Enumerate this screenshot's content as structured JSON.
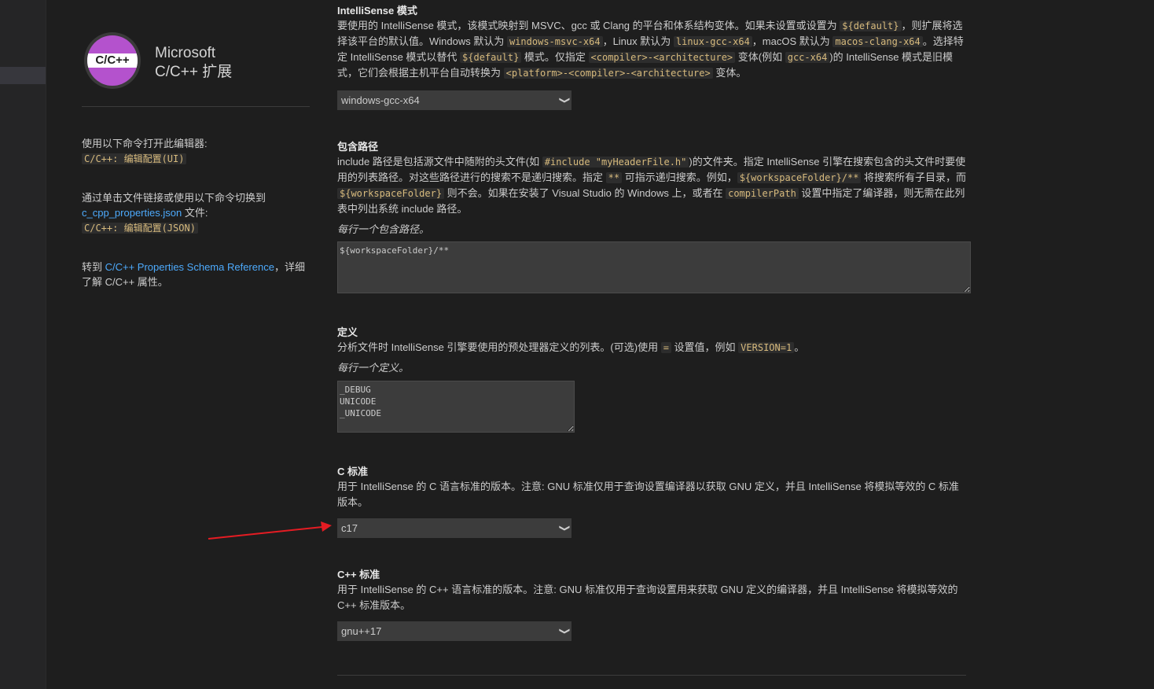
{
  "extension": {
    "logo_text": "C/C++",
    "title_line1": "Microsoft",
    "title_line2": "C/C++ 扩展"
  },
  "sidebar": {
    "open_with_text": "使用以下命令打开此编辑器:",
    "open_ui_command": "C/C++: 编辑配置(UI)",
    "switch_text": "通过单击文件链接或使用以下命令切换到",
    "json_link": "c_cpp_properties.json",
    "json_suffix": " 文件:",
    "open_json_command": "C/C++: 编辑配置(JSON)",
    "goto_prefix": "转到 ",
    "schema_link": "C/C++ Properties Schema Reference",
    "goto_suffix": "，详细了解 C/C++ 属性。"
  },
  "intellisense_mode": {
    "title": "IntelliSense 模式",
    "desc": [
      {
        "t": "要使用的 IntelliSense 模式，该模式映射到 MSVC、gcc 或 Clang 的平台和体系结构变体。如果未设置或设置为 "
      },
      {
        "c": "${default}"
      },
      {
        "t": "，则扩展将选择该平台的默认值。Windows 默认为 "
      },
      {
        "c": "windows-msvc-x64"
      },
      {
        "t": "，Linux 默认为 "
      },
      {
        "c": "linux-gcc-x64"
      },
      {
        "t": "，macOS 默认为 "
      },
      {
        "c": "macos-clang-x64"
      },
      {
        "t": "。选择特定 IntelliSense 模式以替代 "
      },
      {
        "c": "${default}"
      },
      {
        "t": " 模式。仅指定 "
      },
      {
        "c": "<compiler>-<architecture>"
      },
      {
        "t": " 变体(例如 "
      },
      {
        "c": "gcc-x64"
      },
      {
        "t": ")的 IntelliSense 模式是旧模式，它们会根据主机平台自动转换为 "
      },
      {
        "c": "<platform>-<compiler>-<architecture>"
      },
      {
        "t": " 变体。"
      }
    ],
    "value": "windows-gcc-x64"
  },
  "include_path": {
    "title": "包含路径",
    "desc": [
      {
        "t": "include 路径是包括源文件中随附的头文件(如 "
      },
      {
        "c": "#include \"myHeaderFile.h\""
      },
      {
        "t": ")的文件夹。指定 IntelliSense 引擎在搜索包含的头文件时要使用的列表路径。对这些路径进行的搜索不是递归搜索。指定 "
      },
      {
        "c": "**"
      },
      {
        "t": " 可指示递归搜索。例如，"
      },
      {
        "c": "${workspaceFolder}/**"
      },
      {
        "t": " 将搜索所有子目录，而 "
      },
      {
        "c": "${workspaceFolder}"
      },
      {
        "t": " 则不会。如果在安装了 Visual Studio 的 Windows 上，或者在 "
      },
      {
        "c": "compilerPath"
      },
      {
        "t": " 设置中指定了编译器，则无需在此列表中列出系统 include 路径。"
      }
    ],
    "hint": "每行一个包含路径。",
    "value": "${workspaceFolder}/**"
  },
  "defines": {
    "title": "定义",
    "desc": [
      {
        "t": "分析文件时 IntelliSense 引擎要使用的预处理器定义的列表。(可选)使用 "
      },
      {
        "c": "="
      },
      {
        "t": " 设置值，例如 "
      },
      {
        "c": "VERSION=1"
      },
      {
        "t": "。"
      }
    ],
    "hint": "每行一个定义。",
    "value": "_DEBUG\nUNICODE\n_UNICODE"
  },
  "c_standard": {
    "title": "C 标准",
    "desc": [
      {
        "t": "用于 IntelliSense 的 C 语言标准的版本。注意: GNU 标准仅用于查询设置编译器以获取 GNU 定义，并且 IntelliSense 将模拟等效的 C 标准版本。"
      }
    ],
    "value": "c17"
  },
  "cpp_standard": {
    "title": "C++ 标准",
    "desc": [
      {
        "t": "用于 IntelliSense 的 C++ 语言标准的版本。注意: GNU 标准仅用于查询设置用来获取 GNU 定义的编译器，并且 IntelliSense 将模拟等效的 C++ 标准版本。"
      }
    ],
    "value": "gnu++17"
  },
  "colors": {
    "background": "#1e1e1e",
    "link": "#4daafc",
    "code_text": "#d7ba7d",
    "input_bg": "#3c3c3c",
    "arrow": "#e51c23",
    "logo_purple": "#b452cd"
  }
}
